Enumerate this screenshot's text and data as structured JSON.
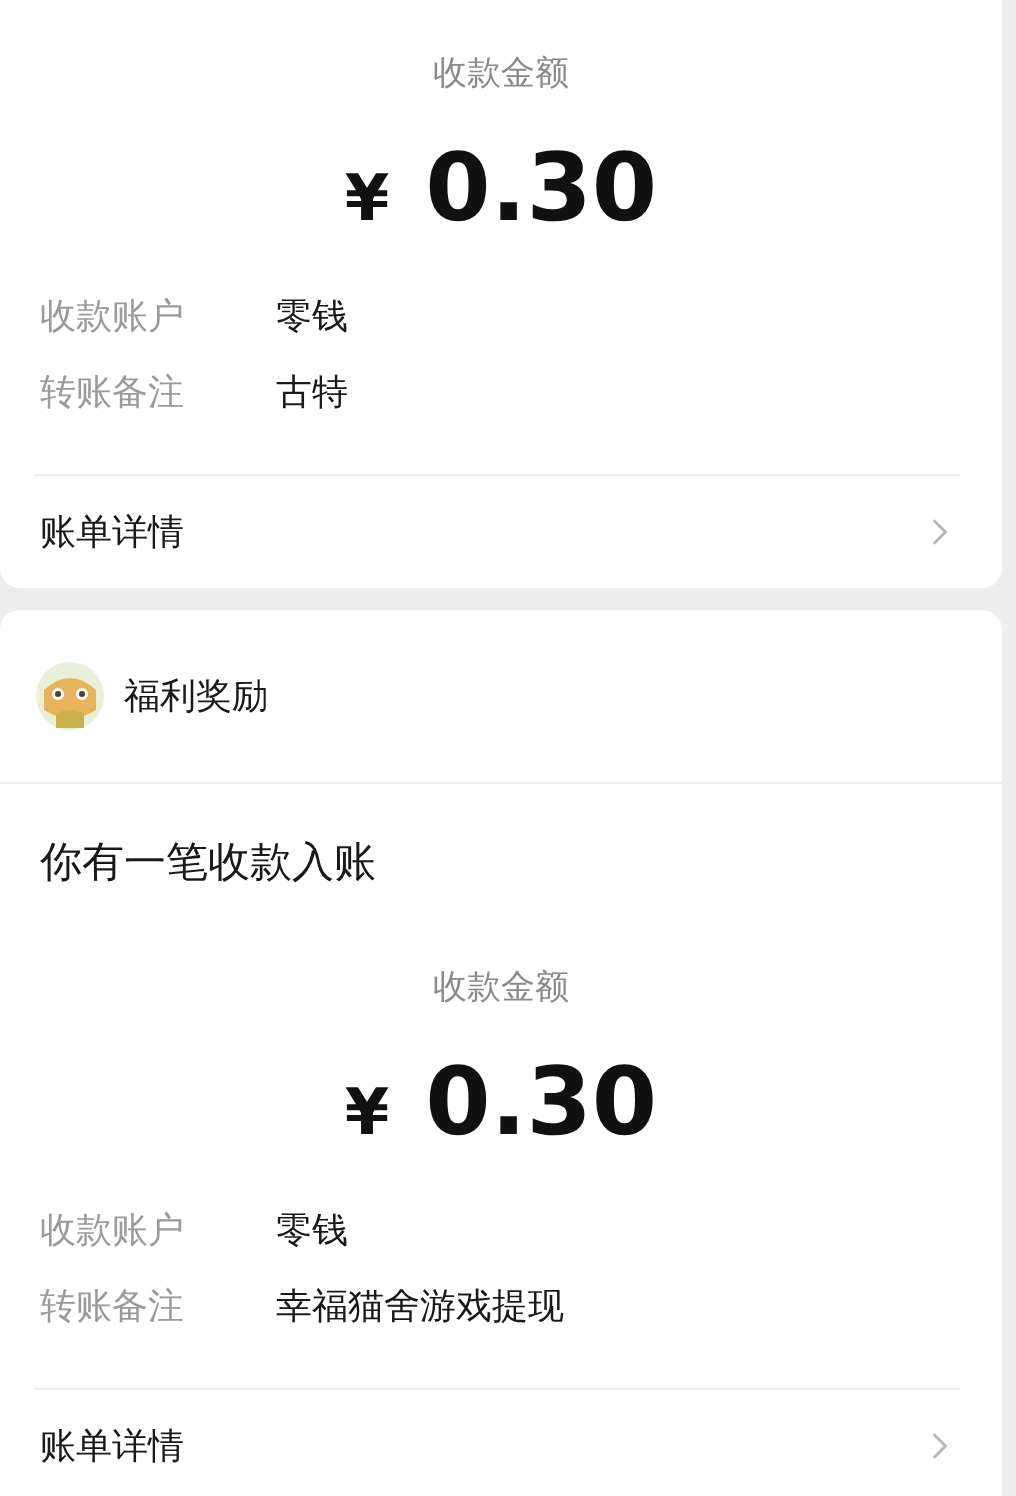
{
  "cards": [
    {
      "amount_label": "收款金额",
      "currency": "¥",
      "amount": "0.30",
      "rows": [
        {
          "label": "收款账户",
          "value": "零钱"
        },
        {
          "label": "转账备注",
          "value": "古特"
        }
      ],
      "detail_link": "账单详情"
    },
    {
      "header": {
        "title": "福利奖励"
      },
      "message": "你有一笔收款入账",
      "amount_label": "收款金额",
      "currency": "¥",
      "amount": "0.30",
      "rows": [
        {
          "label": "收款账户",
          "value": "零钱"
        },
        {
          "label": "转账备注",
          "value": "幸福猫舍游戏提现"
        }
      ],
      "detail_link": "账单详情"
    }
  ]
}
